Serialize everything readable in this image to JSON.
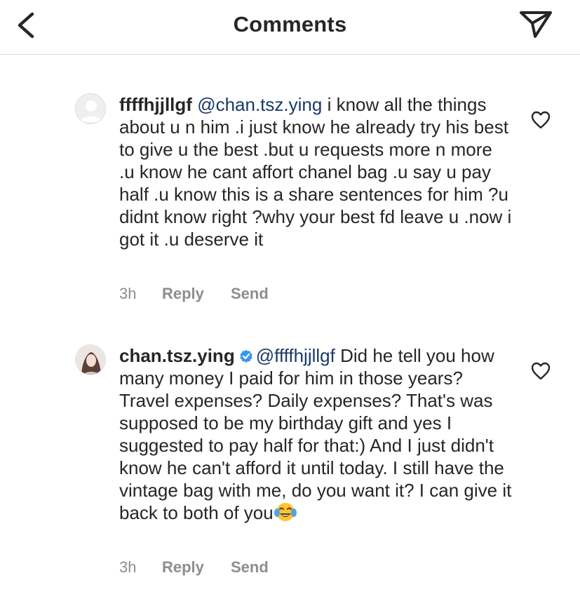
{
  "header": {
    "title": "Comments",
    "back_icon": "chevron-left-icon",
    "send_icon": "paper-plane-icon"
  },
  "comments": [
    {
      "username": "ffffhjjllgf",
      "mention": "@chan.tsz.ying",
      "body": "i know all the things about u n him .i just know he already try his best to give u the best .but u requests more n more .u know he cant affort chanel bag .u say u pay half .u know this is a share sentences for him ?u didnt know right ?why your best fd leave u .now i got it .u deserve it",
      "verified": false,
      "time": "3h",
      "reply_label": "Reply",
      "send_label": "Send",
      "avatar_icon": "default-avatar-icon",
      "like_icon": "heart-outline-icon"
    },
    {
      "username": "chan.tsz.ying",
      "mention": "@ffffhjjllgf",
      "body": "Did he tell you how many money I paid for him in those years? Travel expenses? Daily expenses? That's was supposed to be my birthday gift and yes I suggested to pay half for that:) And I just didn't know he can't afford it until today. I still have the vintage bag with me, do you want it? I can give it back to both of you",
      "emoji": "face-with-tears-of-joy-emoji",
      "verified": true,
      "time": "3h",
      "reply_label": "Reply",
      "send_label": "Send",
      "avatar_icon": "profile-photo-avatar",
      "like_icon": "heart-outline-icon"
    }
  ],
  "colors": {
    "text": "#262626",
    "mention": "#1a3a67",
    "meta": "#8e8e8e",
    "verified": "#3897f0",
    "divider": "#dbdbdb"
  }
}
